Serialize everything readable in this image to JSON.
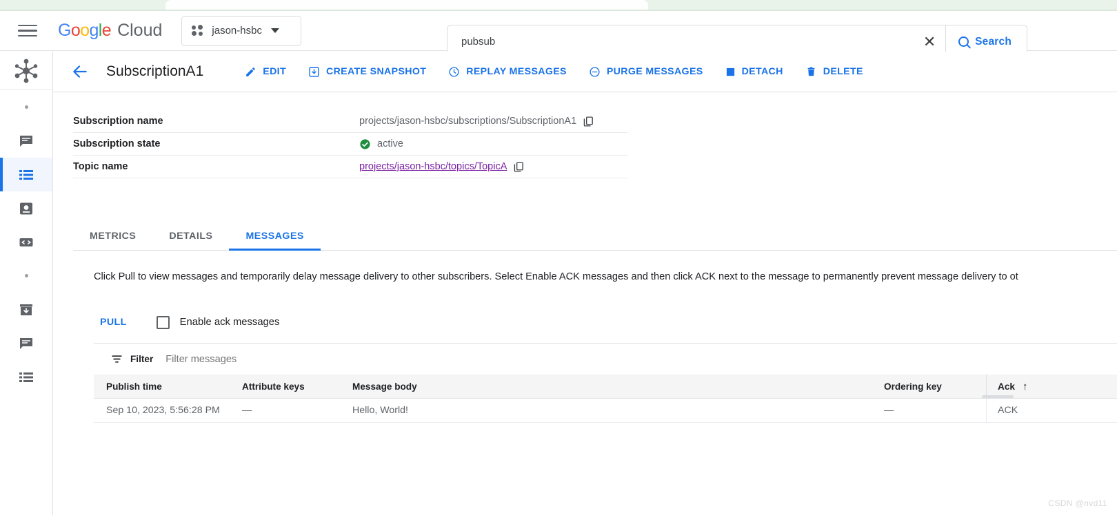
{
  "browser": {
    "tab_ghost_text": "​"
  },
  "topbar": {
    "menu_icon": "hamburger-icon",
    "brand": {
      "google": "Google",
      "cloud": "Cloud"
    },
    "project": {
      "name": "jason-hsbc",
      "icon": "project-dots-icon"
    },
    "search": {
      "value": "pubsub",
      "placeholder": "Search",
      "clear_label": "✕",
      "button_label": "Search"
    }
  },
  "sidebar": {
    "logo_name": "pubsub-hub-icon",
    "items": [
      {
        "name": "separator-dot-1",
        "type": "dot",
        "label": ""
      },
      {
        "name": "sidebar-item-topics",
        "type": "icon",
        "icon": "chat-topics-icon",
        "label": "Topics",
        "active": false
      },
      {
        "name": "sidebar-item-subscriptions",
        "type": "icon",
        "icon": "list-subscriptions-icon",
        "label": "Subscriptions",
        "active": true
      },
      {
        "name": "sidebar-item-snapshots",
        "type": "icon",
        "icon": "snapshot-icon",
        "label": "Snapshots",
        "active": false
      },
      {
        "name": "sidebar-item-schemas",
        "type": "icon",
        "icon": "code-schemas-icon",
        "label": "Schemas",
        "active": false
      },
      {
        "name": "separator-dot-2",
        "type": "dot",
        "label": ""
      },
      {
        "name": "sidebar-item-lite-reservations",
        "type": "icon",
        "icon": "archive-reservations-icon",
        "label": "Lite Reservations",
        "active": false
      },
      {
        "name": "sidebar-item-lite-topics",
        "type": "icon",
        "icon": "chat-lite-topics-icon",
        "label": "Lite Topics",
        "active": false
      },
      {
        "name": "sidebar-item-lite-subscriptions",
        "type": "icon",
        "icon": "list-lite-subscriptions-icon",
        "label": "Lite Subscriptions",
        "active": false
      }
    ]
  },
  "page": {
    "back_label": "Back",
    "title": "SubscriptionA1",
    "actions": [
      {
        "name": "edit-button",
        "label": "EDIT",
        "icon": "pencil-icon"
      },
      {
        "name": "create-snapshot-button",
        "label": "CREATE SNAPSHOT",
        "icon": "snapshot-add-icon"
      },
      {
        "name": "replay-messages-button",
        "label": "REPLAY MESSAGES",
        "icon": "clock-icon"
      },
      {
        "name": "purge-messages-button",
        "label": "PURGE MESSAGES",
        "icon": "minus-circle-icon"
      },
      {
        "name": "detach-button",
        "label": "DETACH",
        "icon": "square-icon"
      },
      {
        "name": "delete-button",
        "label": "DELETE",
        "icon": "trash-icon"
      }
    ]
  },
  "details": {
    "rows": [
      {
        "key": "Subscription name",
        "value": "projects/jason-hsbc/subscriptions/SubscriptionA1",
        "kind": "copyable"
      },
      {
        "key": "Subscription state",
        "value": "active",
        "kind": "status",
        "status_color": "#1e8e3e"
      },
      {
        "key": "Topic name",
        "value": "projects/jason-hsbc/topics/TopicA",
        "kind": "link",
        "link_color": "#7b1fa2"
      }
    ]
  },
  "tabs": [
    {
      "name": "tab-metrics",
      "label": "METRICS",
      "active": false
    },
    {
      "name": "tab-details",
      "label": "DETAILS",
      "active": false
    },
    {
      "name": "tab-messages",
      "label": "MESSAGES",
      "active": true
    }
  ],
  "messages_panel": {
    "help_text": "Click Pull to view messages and temporarily delay message delivery to other subscribers. Select Enable ACK messages and then click ACK next to the message to permanently prevent message delivery to ot",
    "pull_label": "PULL",
    "enable_ack_label": "Enable ack messages",
    "enable_ack_checked": false,
    "filter": {
      "label": "Filter",
      "placeholder": "Filter messages",
      "value": "",
      "icon": "filter-icon"
    },
    "table": {
      "columns": [
        {
          "name": "col-publish-time",
          "label": "Publish time"
        },
        {
          "name": "col-attribute-keys",
          "label": "Attribute keys"
        },
        {
          "name": "col-message-body",
          "label": "Message body"
        },
        {
          "name": "col-ordering-key",
          "label": "Ordering key"
        },
        {
          "name": "col-ack",
          "label": "Ack",
          "sort": "↑"
        }
      ],
      "rows": [
        {
          "publish_time": "Sep 10, 2023, 5:56:28 PM",
          "attribute_keys": "—",
          "message_body": "Hello, World!",
          "ordering_key": "—",
          "ack": "ACK"
        }
      ]
    }
  },
  "watermark": "CSDN @nvd11",
  "colors": {
    "accent": "#1a73e8",
    "link_visited": "#7b1fa2",
    "status_active": "#1e8e3e"
  }
}
